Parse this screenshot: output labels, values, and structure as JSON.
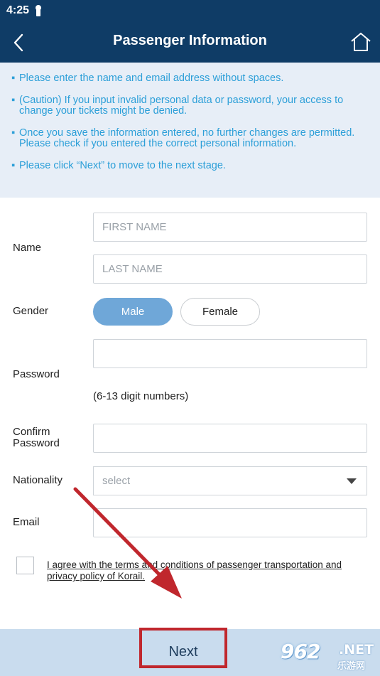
{
  "status_bar": {
    "time": "4:25"
  },
  "header": {
    "title": "Passenger Information"
  },
  "notices": [
    "Please enter the name and email address without spaces.",
    "(Caution) If you input invalid personal data or password, your access to change your tickets might be denied.",
    "Once you save the information entered, no further changes are permitted. Please check if you entered the correct personal information.",
    "Please click “Next” to move to the next stage."
  ],
  "form": {
    "name_label": "Name",
    "first_name_placeholder": "FIRST NAME",
    "last_name_placeholder": "LAST NAME",
    "gender_label": "Gender",
    "gender_male": "Male",
    "gender_female": "Female",
    "gender_selected": "Male",
    "password_label": "Password",
    "password_hint": "(6-13 digit numbers)",
    "confirm_label_1": "Confirm",
    "confirm_label_2": "Password",
    "nationality_label": "Nationality",
    "nationality_value": "select",
    "email_label": "Email",
    "agree_text": "I agree with the terms and conditions of passenger transportation and privacy policy of Korail."
  },
  "footer": {
    "next_label": "Next"
  },
  "watermark": {
    "number": "962",
    "suffix": ".NET",
    "subtext": "乐游网"
  },
  "colors": {
    "header_bg": "#0f3c66",
    "notice_text": "#2c9fd8",
    "selected_gender": "#6fa7d8",
    "annotation_red": "#c0272d",
    "footer_bg": "#c9dcee"
  }
}
